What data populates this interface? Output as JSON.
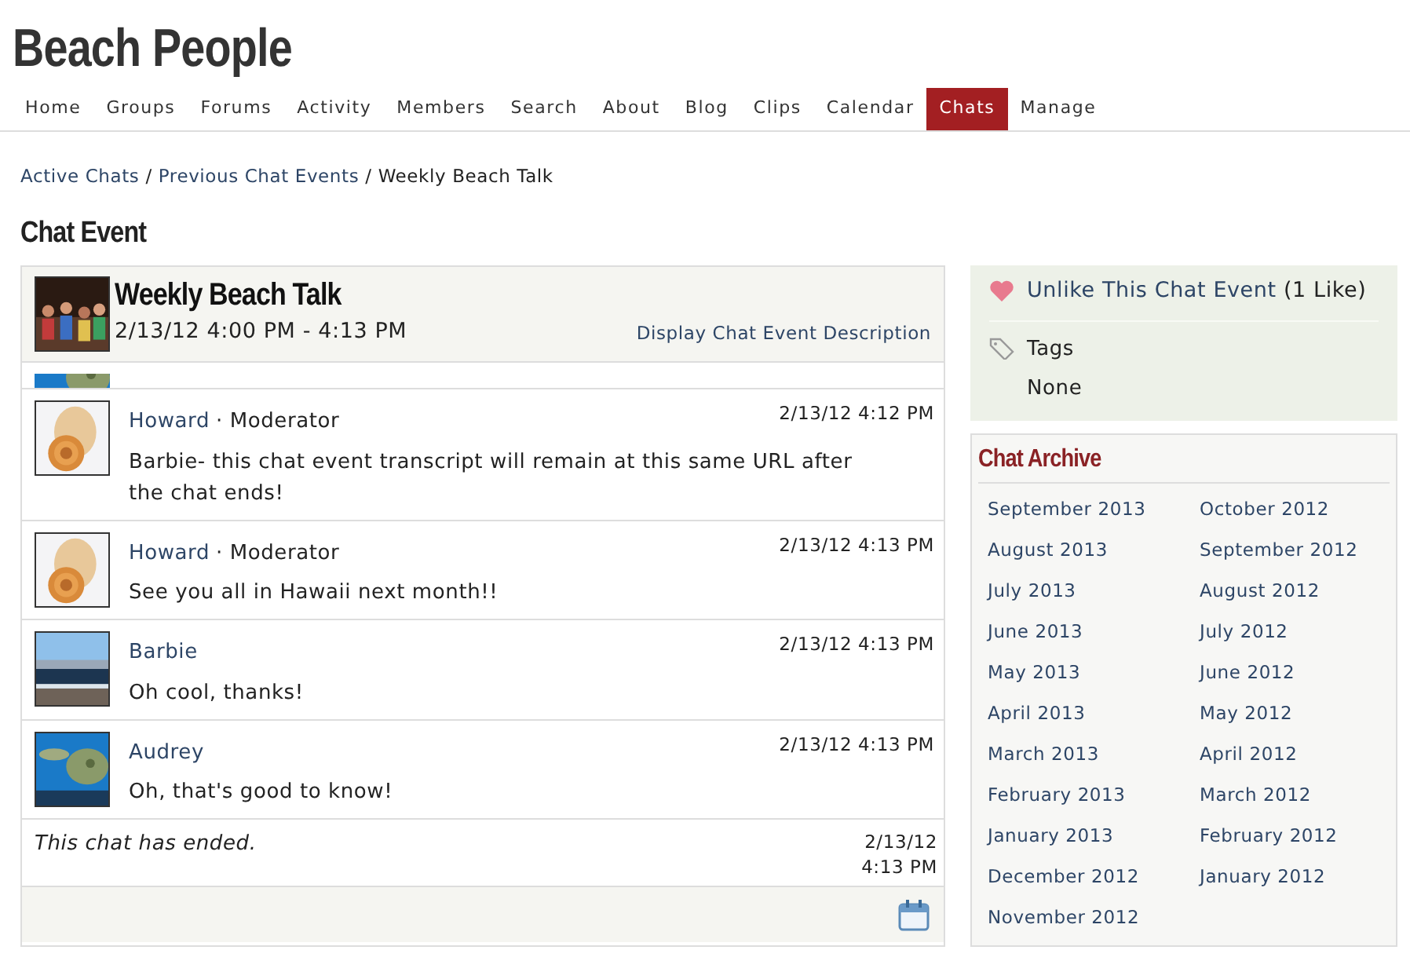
{
  "site": {
    "title": "Beach People"
  },
  "nav": [
    {
      "label": "Home",
      "selected": false
    },
    {
      "label": "Groups",
      "selected": false
    },
    {
      "label": "Forums",
      "selected": false
    },
    {
      "label": "Activity",
      "selected": false
    },
    {
      "label": "Members",
      "selected": false
    },
    {
      "label": "Search",
      "selected": false
    },
    {
      "label": "About",
      "selected": false
    },
    {
      "label": "Blog",
      "selected": false
    },
    {
      "label": "Clips",
      "selected": false
    },
    {
      "label": "Calendar",
      "selected": false
    },
    {
      "label": "Chats",
      "selected": true
    },
    {
      "label": "Manage",
      "selected": false
    }
  ],
  "breadcrumb": {
    "separator": "/",
    "items": [
      "Active Chats",
      "Previous Chat Events",
      "Weekly Beach Talk"
    ]
  },
  "page_title": "Chat Event",
  "event": {
    "title": "Weekly Beach Talk",
    "time": "2/13/12 4:00 PM - 4:13 PM",
    "description_link": "Display Chat Event Description"
  },
  "messages": [
    {
      "author": "Howard",
      "role": "· Moderator",
      "time": "2/13/12 4:12 PM",
      "text": "Barbie- this chat event transcript will remain at this same URL after the chat ends!"
    },
    {
      "author": "Howard",
      "role": "· Moderator",
      "time": "2/13/12 4:13 PM",
      "text": "See you all in Hawaii next month!!"
    },
    {
      "author": "Barbie",
      "time": "2/13/12 4:13 PM",
      "text": "Oh cool, thanks!"
    },
    {
      "author": "Audrey",
      "time": "2/13/12 4:13 PM",
      "text": "Oh, that's good to know!"
    }
  ],
  "ended": {
    "text": "This chat has ended.",
    "date": "2/13/12",
    "time": "4:13 PM"
  },
  "like": {
    "link": "Unlike This Chat Event",
    "count": "(1 Like)"
  },
  "tags": {
    "label": "Tags",
    "value": "None"
  },
  "archive": {
    "title": "Chat Archive",
    "months": [
      "September 2013",
      "August 2013",
      "July 2013",
      "June 2013",
      "May 2013",
      "April 2013",
      "March 2013",
      "February 2013",
      "January 2013",
      "December 2012",
      "November 2012",
      "October 2012",
      "September 2012",
      "August 2012",
      "July 2012",
      "June 2012",
      "May 2012",
      "April 2012",
      "March 2012",
      "February 2012",
      "January 2012"
    ]
  }
}
